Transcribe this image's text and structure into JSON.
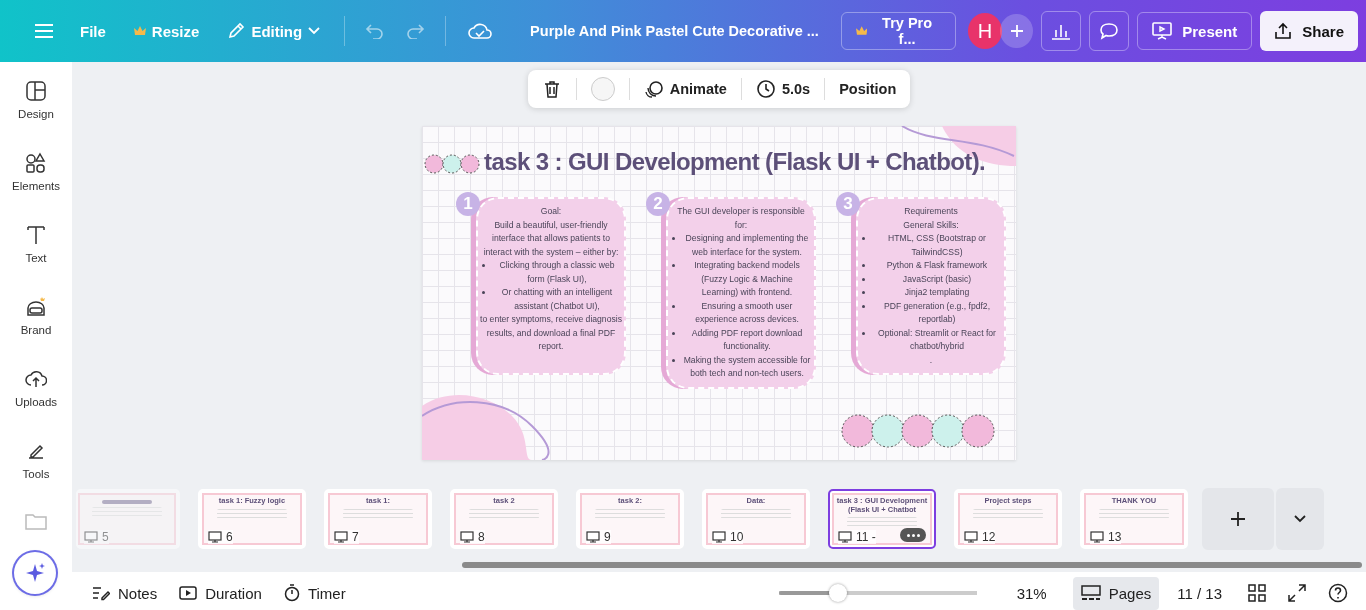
{
  "topbar": {
    "file": "File",
    "resize": "Resize",
    "editing": "Editing",
    "title": "Purple And Pink Pastel Cute Decorative ...",
    "try_pro": "Try Pro f...",
    "avatar": "H",
    "present": "Present",
    "share": "Share"
  },
  "sidebar": [
    {
      "label": "Design"
    },
    {
      "label": "Elements"
    },
    {
      "label": "Text"
    },
    {
      "label": "Brand"
    },
    {
      "label": "Uploads"
    },
    {
      "label": "Tools"
    }
  ],
  "toolbar": {
    "animate": "Animate",
    "duration": "5.0s",
    "position": "Position"
  },
  "slide": {
    "title": "task 3 : GUI Development (Flask UI + Chatbot).",
    "columns": [
      {
        "number": "1",
        "lines": [
          {
            "text": "Goal:",
            "bullet": false
          },
          {
            "text": "Build a beautiful, user-friendly interface that allows patients to interact with the system – either by:",
            "bullet": false
          },
          {
            "text": "Clicking through a classic web form (Flask UI),",
            "bullet": true
          },
          {
            "text": "Or chatting with an intelligent assistant (Chatbot UI),",
            "bullet": true
          },
          {
            "text": "to enter symptoms, receive diagnosis results, and download a final PDF report.",
            "bullet": false
          }
        ]
      },
      {
        "number": "2",
        "lines": [
          {
            "text": "The GUI developer is responsible for:",
            "bullet": false
          },
          {
            "text": "Designing and implementing the web interface for the system.",
            "bullet": true
          },
          {
            "text": "Integrating backend models (Fuzzy Logic & Machine Learning) with frontend.",
            "bullet": true
          },
          {
            "text": "Ensuring a smooth user experience across devices.",
            "bullet": true
          },
          {
            "text": "Adding PDF report download functionality.",
            "bullet": true
          },
          {
            "text": "Making the system accessible for both tech and non-tech users.",
            "bullet": true
          }
        ]
      },
      {
        "number": "3",
        "lines": [
          {
            "text": "Requirements",
            "bullet": false
          },
          {
            "text": "General Skills:",
            "bullet": false
          },
          {
            "text": "HTML, CSS (Bootstrap or TailwindCSS)",
            "bullet": true
          },
          {
            "text": "Python & Flask framework",
            "bullet": true
          },
          {
            "text": "JavaScript (basic)",
            "bullet": true
          },
          {
            "text": "Jinja2 templating",
            "bullet": true
          },
          {
            "text": "PDF generation (e.g., fpdf2, reportlab)",
            "bullet": true
          },
          {
            "text": "Optional: Streamlit or React for chatbot/hybrid",
            "bullet": true
          },
          {
            "text": ".",
            "bullet": false
          }
        ]
      }
    ]
  },
  "pages": [
    {
      "number": "5",
      "selected": false
    },
    {
      "number": "6",
      "title": "task 1: Fuzzy logic",
      "selected": false
    },
    {
      "number": "7",
      "title": "task 1:",
      "selected": false
    },
    {
      "number": "8",
      "title": "task 2",
      "selected": false
    },
    {
      "number": "9",
      "title": "task 2:",
      "selected": false
    },
    {
      "number": "10",
      "title": "Data:",
      "selected": false
    },
    {
      "number": "11 -",
      "title": "task 3 : GUI Development (Flask UI + Chatbot",
      "selected": true
    },
    {
      "number": "12",
      "title": "Project steps",
      "selected": false
    },
    {
      "number": "13",
      "title": "THANK YOU",
      "selected": false
    }
  ],
  "bottombar": {
    "notes": "Notes",
    "duration": "Duration",
    "timer": "Timer",
    "zoom": {
      "level": 0.3
    },
    "zoom_reading": "31%",
    "pages": "Pages",
    "page_count": "11 / 13"
  }
}
